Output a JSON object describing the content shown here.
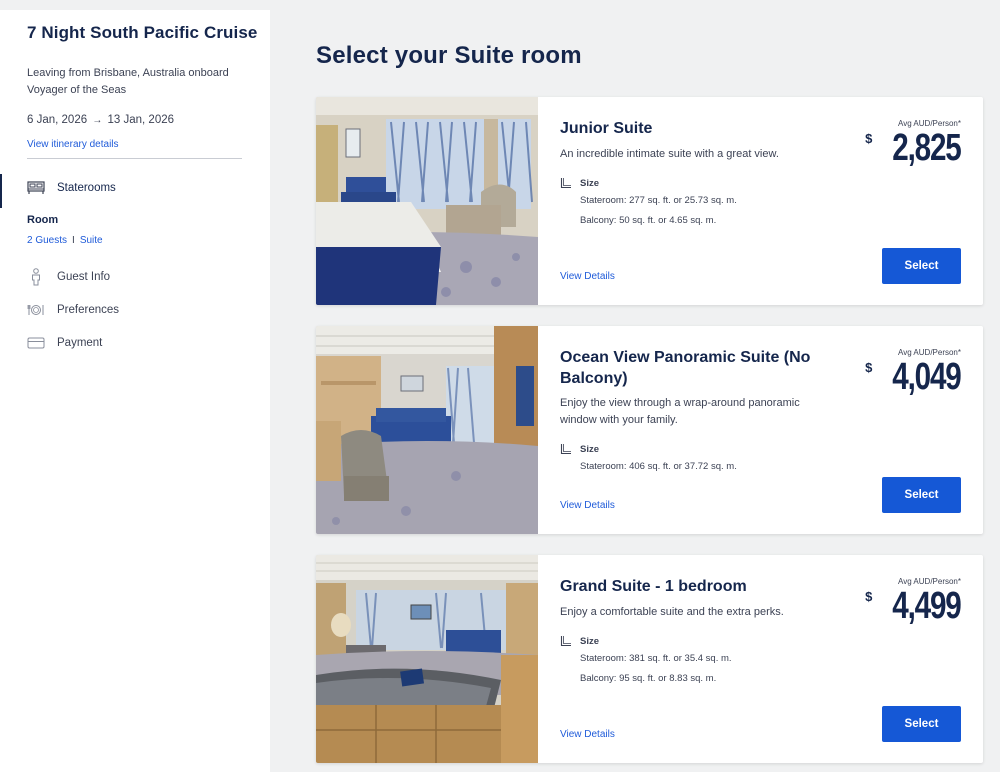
{
  "trip": {
    "title": "7 Night South Pacific Cruise",
    "description": "Leaving from Brisbane, Australia onboard Voyager of the Seas",
    "date_start": "6 Jan, 2026",
    "date_end": "13 Jan, 2026",
    "itinerary_link": "View itinerary details"
  },
  "nav": {
    "staterooms": "Staterooms",
    "room_label": "Room",
    "room_guests": "2 Guests",
    "room_sep": "I",
    "room_type": "Suite",
    "guest_info": "Guest Info",
    "preferences": "Preferences",
    "payment": "Payment"
  },
  "main": {
    "title": "Select your Suite room"
  },
  "common": {
    "avg_label": "Avg AUD/Person*",
    "currency": "$",
    "size_label": "Size",
    "view_details": "View Details",
    "select": "Select"
  },
  "colors": {
    "navy": "#15264c",
    "link_blue": "#1f5bd9",
    "button_blue": "#1558d6",
    "page_bg": "#f0f1f2"
  },
  "suites": [
    {
      "name": "Junior Suite",
      "description": "An incredible intimate suite with a great view.",
      "stateroom": "Stateroom: 277 sq. ft. or 25.73 sq. m.",
      "balcony": "Balcony: 50 sq. ft. or 4.65 sq. m.",
      "price": "2,825"
    },
    {
      "name": "Ocean View Panoramic Suite (No Balcony)",
      "description": "Enjoy the view through a wrap-around panoramic window with your family.",
      "stateroom": "Stateroom: 406 sq. ft. or 37.72 sq. m.",
      "balcony": "",
      "price": "4,049"
    },
    {
      "name": "Grand Suite - 1 bedroom",
      "description": "Enjoy a comfortable suite and the extra perks.",
      "stateroom": "Stateroom: 381 sq. ft. or 35.4 sq. m.",
      "balcony": "Balcony: 95 sq. ft. or 8.83 sq. m.",
      "price": "4,499"
    }
  ]
}
